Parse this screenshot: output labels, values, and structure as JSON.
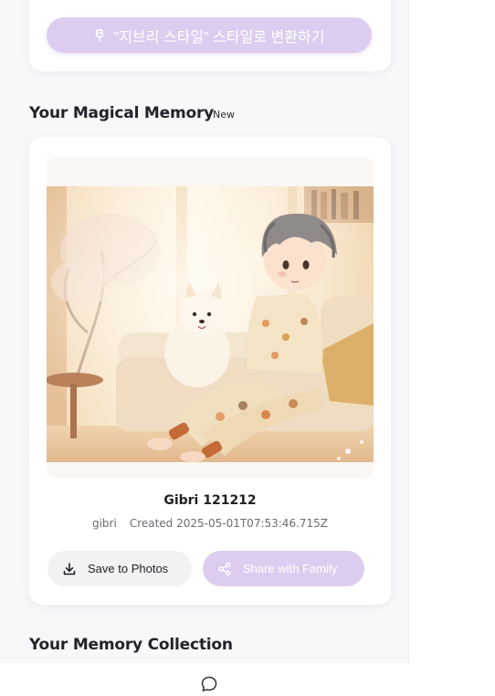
{
  "convert_button": {
    "label": "\"지브리 스타일\" 스타일로 변환하기",
    "icon": "pen-icon"
  },
  "magical_memory": {
    "heading": "Your Magical Memory",
    "badge": "New",
    "image": {
      "description_icon": "ghibli-illustration"
    },
    "title": "Gibri 121212",
    "style": "gibri",
    "created": "Created 2025-05-01T07:53:46.715Z",
    "save_button": {
      "label": "Save to Photos",
      "icon": "download-icon"
    },
    "share_button": {
      "label": "Share with Family",
      "icon": "share-icon"
    }
  },
  "collection": {
    "heading": "Your Memory Collection"
  },
  "footer": {
    "icon": "chat-bubble-icon"
  },
  "colors": {
    "accent_light": "#dccdf0",
    "page_bg": "#f8f7fa",
    "card_bg": "#ffffff"
  }
}
